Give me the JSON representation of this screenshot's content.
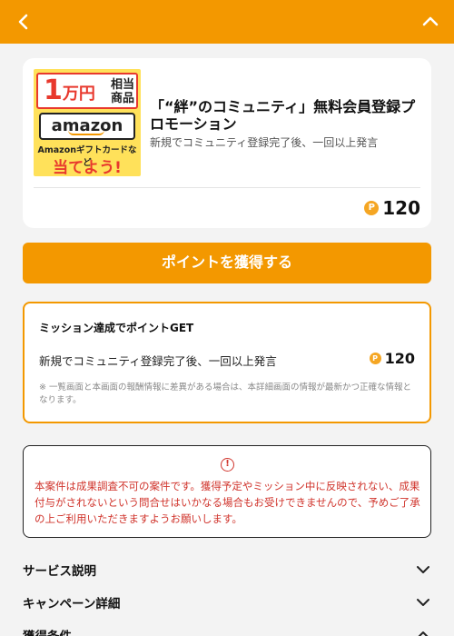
{
  "header": {
    "back_icon": "chevron-left-icon",
    "collapse_icon": "chevron-up-icon",
    "bg_color": "#f39800"
  },
  "offer": {
    "image": {
      "amount": "1",
      "amount_unit": "万円",
      "equivalent": "相当商品",
      "brand": "amazon",
      "gift_text": "Amazonギフトカードなど",
      "win_text": "当てよう!"
    },
    "title": "「“絆”のコミュニティ」無料会員登録プロモーション",
    "subtitle": "新規でコミュニティ登録完了後、一回以上発言",
    "point_icon": "P",
    "points": "120"
  },
  "cta": {
    "label": "ポイントを獲得する"
  },
  "mission": {
    "heading": "ミッション達成でポイントGET",
    "task": "新規でコミュニティ登録完了後、一回以上発言",
    "point_icon": "P",
    "points": "120",
    "note": "※ 一覧画面と本画面の報酬情報に差異がある場合は、本詳細画面の情報が最新かつ正確な情報となります。"
  },
  "warning": {
    "icon": "!",
    "text": "本案件は成果調査不可の案件です。獲得予定やミッション中に反映されない、成果付与がされないという問合せはいかなる場合もお受けできませんので、予めご了承の上ご利用いただきますようお願いします。"
  },
  "sections": [
    {
      "label": "サービス説明",
      "icon": "chevron-down-icon"
    },
    {
      "label": "キャンペーン詳細",
      "icon": "chevron-down-icon"
    },
    {
      "label": "獲得条件",
      "icon": "chevron-up-icon"
    }
  ],
  "colors": {
    "accent": "#f39800",
    "warning": "#d0342c",
    "coin": "#f5a623"
  }
}
